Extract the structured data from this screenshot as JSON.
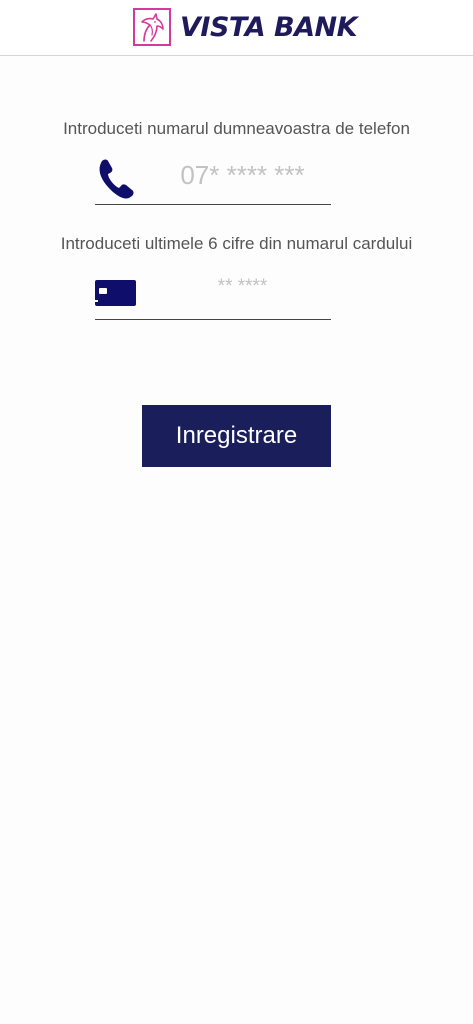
{
  "header": {
    "brand_name": "VISTA BANK",
    "logo_icon": "horse-head-logo-icon",
    "brand_color": "#1f1a5c",
    "logo_color": "#d6399a"
  },
  "form": {
    "phone_label": "Introduceti numarul dumneavoastra de telefon",
    "phone_icon": "phone-icon",
    "phone_placeholder": "07* **** ***",
    "card_label": "Introduceti ultimele 6 cifre din numarul cardului",
    "card_icon": "credit-card-icon",
    "card_placeholder": "** ****",
    "icon_color": "#0f0f6b"
  },
  "actions": {
    "register_label": "Inregistrare",
    "button_color": "#1a1f5c"
  }
}
